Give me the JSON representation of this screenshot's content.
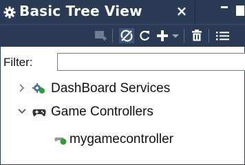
{
  "panel": {
    "title": "Basic Tree View",
    "close_glyph": "×",
    "title_icon": "gear-icon"
  },
  "toolbar": {
    "items": [
      {
        "name": "add-item-icon",
        "enabled": false
      },
      {
        "name": "no-sync-icon",
        "enabled": true
      },
      {
        "name": "refresh-icon",
        "enabled": true
      },
      {
        "name": "add-icon",
        "enabled": true
      },
      {
        "name": "dropdown-icon",
        "enabled": true
      },
      {
        "name": "delete-icon",
        "enabled": true
      },
      {
        "name": "list-icon",
        "enabled": true
      }
    ]
  },
  "filter": {
    "label": "Filter:",
    "value": "",
    "placeholder": ""
  },
  "tree": {
    "nodes": [
      {
        "label": "DashBoard Services",
        "expanded": false,
        "icon": "services-icon",
        "level": 0
      },
      {
        "label": "Game Controllers",
        "expanded": true,
        "icon": "gamepad-icon",
        "level": 0
      },
      {
        "label": "mygamecontroller",
        "expanded": null,
        "icon": "controller-status-icon",
        "level": 1
      }
    ]
  },
  "colors": {
    "title_bar": "#2b3a55",
    "toolbar": "#2b3a55",
    "status_green": "#2e9e2e",
    "text": "#111111"
  }
}
